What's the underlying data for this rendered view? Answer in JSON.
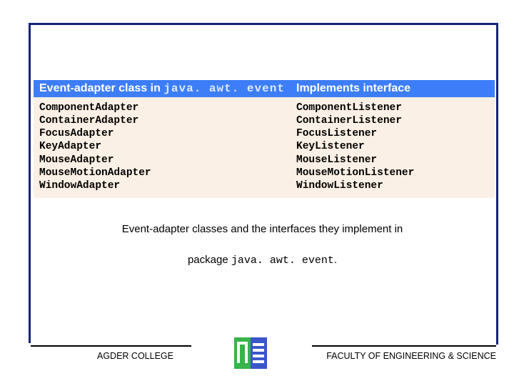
{
  "table": {
    "header": {
      "col1_prefix": "Event-adapter class in ",
      "col1_code": "java. awt. event",
      "col2": "Implements interface"
    },
    "rows": {
      "adapters": "ComponentAdapter\nContainerAdapter\nFocusAdapter\nKeyAdapter\nMouseAdapter\nMouseMotionAdapter\nWindowAdapter",
      "listeners": "ComponentListener\nContainerListener\nFocusListener\nKeyListener\nMouseListener\nMouseMotionListener\nWindowListener"
    }
  },
  "chart_data": {
    "type": "table",
    "title": "Event-adapter classes and the interfaces they implement in package java.awt.event",
    "columns": [
      "Event-adapter class in java.awt.event",
      "Implements interface"
    ],
    "rows": [
      [
        "ComponentAdapter",
        "ComponentListener"
      ],
      [
        "ContainerAdapter",
        "ContainerListener"
      ],
      [
        "FocusAdapter",
        "FocusListener"
      ],
      [
        "KeyAdapter",
        "KeyListener"
      ],
      [
        "MouseAdapter",
        "MouseListener"
      ],
      [
        "MouseMotionAdapter",
        "MouseMotionListener"
      ],
      [
        "WindowAdapter",
        "WindowListener"
      ]
    ]
  },
  "caption": {
    "line1": "Event-adapter classes and the interfaces they implement in",
    "line2_prefix": "package ",
    "line2_code": "java. awt. event",
    "line2_suffix": "."
  },
  "footer": {
    "left": "AGDER COLLEGE",
    "right": "FACULTY OF ENGINEERING & SCIENCE"
  }
}
